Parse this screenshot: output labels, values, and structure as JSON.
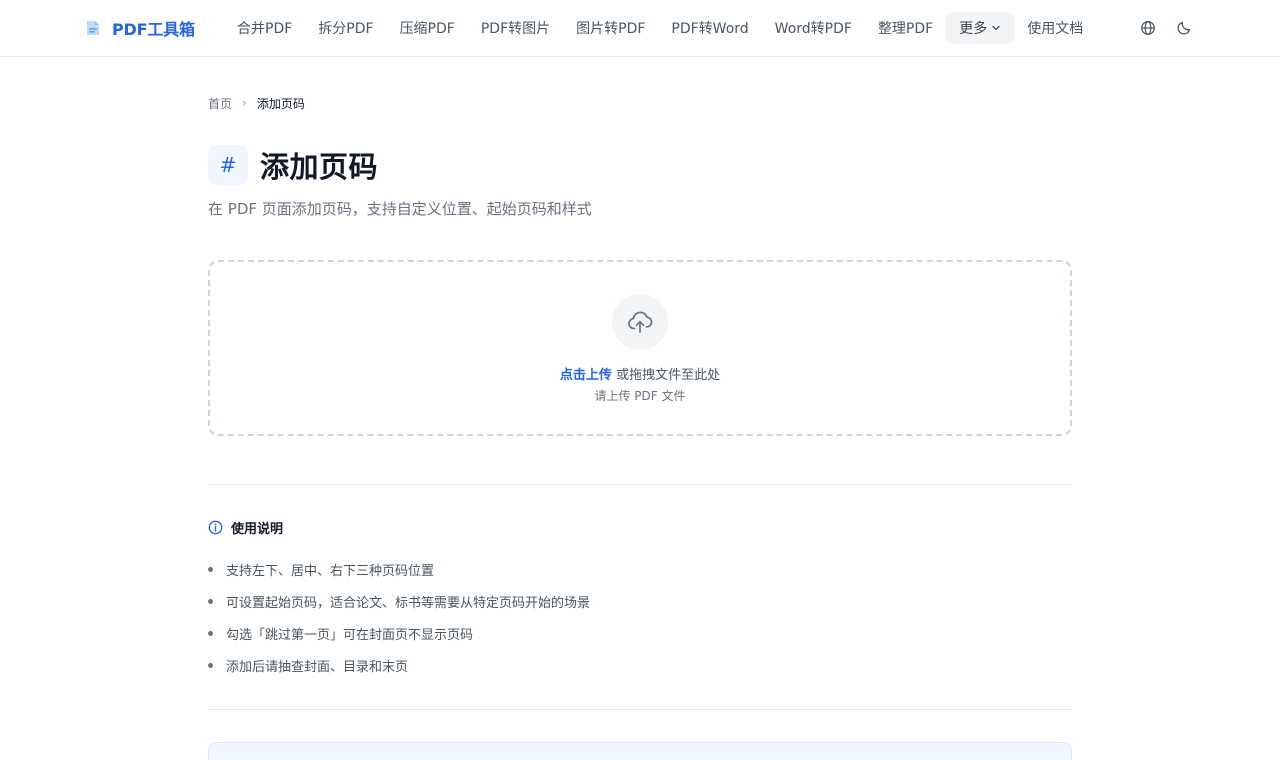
{
  "brand": {
    "name": "PDF工具箱",
    "icon": "pdf-file-icon"
  },
  "nav": {
    "items": [
      "合并PDF",
      "拆分PDF",
      "压缩PDF",
      "PDF转图片",
      "图片转PDF",
      "PDF转Word",
      "Word转PDF",
      "整理PDF"
    ],
    "more_label": "更多",
    "docs_label": "使用文档"
  },
  "toolbar": {
    "language_icon": "globe-icon",
    "theme_icon": "moon-icon"
  },
  "breadcrumb": {
    "home": "首页",
    "separator": "›",
    "current": "添加页码"
  },
  "page": {
    "icon_glyph": "#",
    "title": "添加页码",
    "subtitle": "在 PDF 页面添加页码，支持自定义位置、起始页码和样式"
  },
  "upload": {
    "icon": "cloud-upload-icon",
    "click_label": "点击上传",
    "drag_text": " 或拖拽文件至此处",
    "hint": "请上传 PDF 文件"
  },
  "usage": {
    "title": "使用说明",
    "items": [
      "支持左下、居中、右下三种页码位置",
      "可设置起始页码，适合论文、标书等需要从特定页码开始的场景",
      "勾选「跳过第一页」可在封面页不显示页码",
      "添加后请抽查封面、目录和末页"
    ]
  },
  "colors": {
    "accent": "#2563eb",
    "text": "#111827",
    "muted": "#6b7280",
    "border": "#e5e7eb"
  }
}
